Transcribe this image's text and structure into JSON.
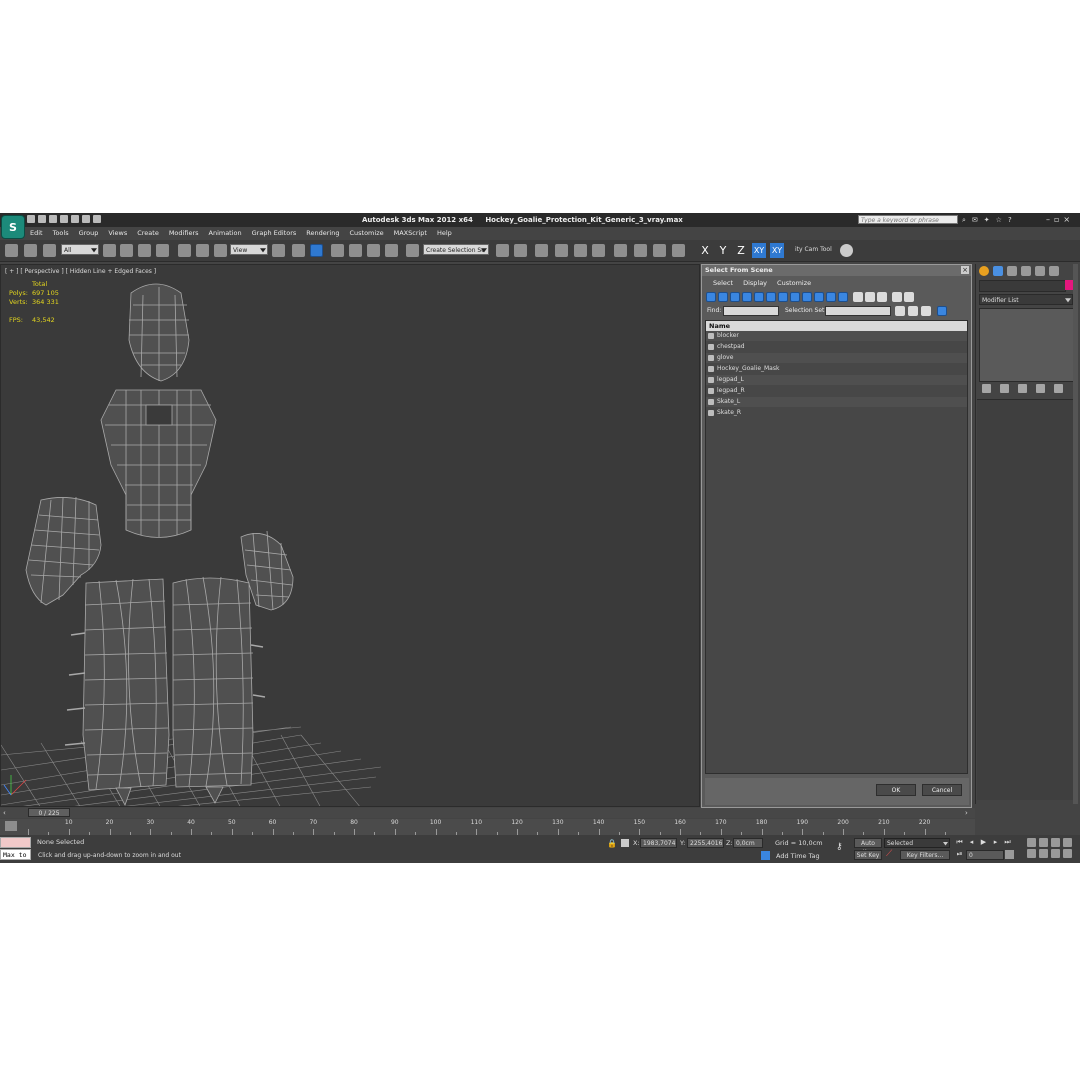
{
  "app": {
    "title": "Autodesk 3ds Max  2012 x64",
    "file": "Hockey_Goalie_Protection_Kit_Generic_3_vray.max",
    "search_placeholder": "Type a keyword or phrase"
  },
  "menu": [
    "Edit",
    "Tools",
    "Group",
    "Views",
    "Create",
    "Modifiers",
    "Animation",
    "Graph Editors",
    "Rendering",
    "Customize",
    "MAXScript",
    "Help"
  ],
  "toolbar": {
    "filter": "All",
    "ref_coord": "View",
    "named_selection": "Create Selection Se",
    "axes": [
      "X",
      "Y",
      "Z",
      "XY",
      "XY"
    ],
    "cam_tool": "ity Cam Tool"
  },
  "viewport": {
    "label": "[ + ] [ Perspective ] [ Hidden Line + Edged Faces ]",
    "stats": {
      "total_label": "Total",
      "polys_label": "Polys:",
      "polys": "697 105",
      "verts_label": "Verts:",
      "verts": "364 331",
      "fps_label": "FPS:",
      "fps": "43,542"
    }
  },
  "dialog": {
    "title": "Select From Scene",
    "menu": [
      "Select",
      "Display",
      "Customize"
    ],
    "find_label": "Find:",
    "selection_set_label": "Selection Set:",
    "column": "Name",
    "items": [
      "blocker",
      "chestpad",
      "glove",
      "Hockey_Goalie_Mask",
      "legpad_L",
      "legpad_R",
      "Skate_L",
      "Skate_R"
    ],
    "ok": "OK",
    "cancel": "Cancel"
  },
  "command_panel": {
    "modifier_list": "Modifier List",
    "object_color": "#e5177e"
  },
  "timeline": {
    "slider": "0 / 225",
    "ticks": [
      10,
      20,
      30,
      40,
      50,
      60,
      70,
      80,
      90,
      100,
      110,
      120,
      130,
      140,
      150,
      160,
      170,
      180,
      190,
      200,
      210,
      220
    ]
  },
  "status": {
    "maxscript": "Max to",
    "selection": "None Selected",
    "prompt": "Click and drag up-and-down to zoom in and out",
    "x_label": "X:",
    "x": "1983,7074",
    "y_label": "Y:",
    "y": "2255,4016",
    "z_label": "Z:",
    "z": "0,0cm",
    "grid": "Grid = 10,0cm",
    "add_time_tag": "Add Time Tag",
    "auto_key": "Auto Key",
    "set_key": "Set Key",
    "key_mode": "Selected",
    "key_filters": "Key Filters...",
    "frame": "0"
  }
}
